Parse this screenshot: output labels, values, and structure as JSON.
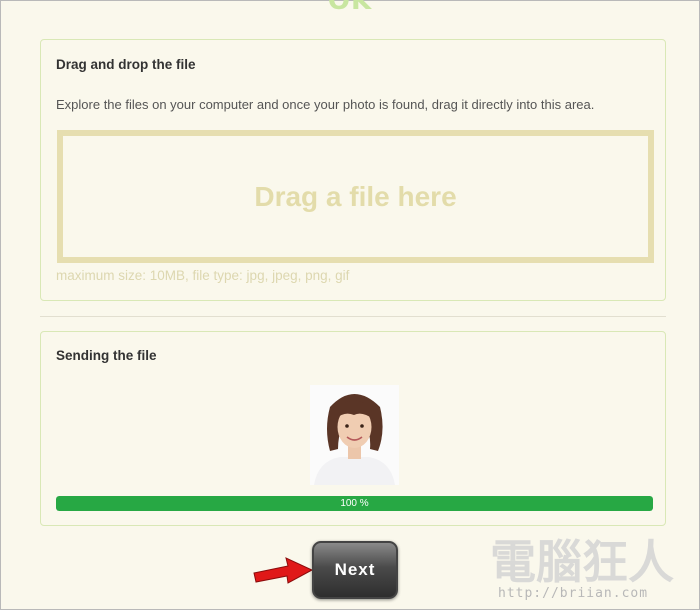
{
  "header": {
    "title": "OK"
  },
  "drag_section": {
    "title": "Drag and drop the file",
    "description": "Explore the files on your computer and once your photo is found, drag it directly into this area.",
    "dropzone_label": "Drag a file here",
    "hint": "maximum size: 10MB, file type: jpg, jpeg, png, gif"
  },
  "send_section": {
    "title": "Sending the file",
    "progress": {
      "value": 100,
      "label": "100 %"
    }
  },
  "actions": {
    "next_label": "Next"
  },
  "watermark": {
    "text": "電腦狂人",
    "sub": "http://briian.com"
  },
  "colors": {
    "background": "#faf8ec",
    "panel_border": "#d9e8b6",
    "dropzone_border": "#e6deb0",
    "progress_fill": "#27a844",
    "button_dark": "#2e2e2e",
    "arrow_red": "#e01818"
  },
  "icons": {
    "arrow": "red-pointer-arrow-icon",
    "photo": "portrait-photo"
  }
}
